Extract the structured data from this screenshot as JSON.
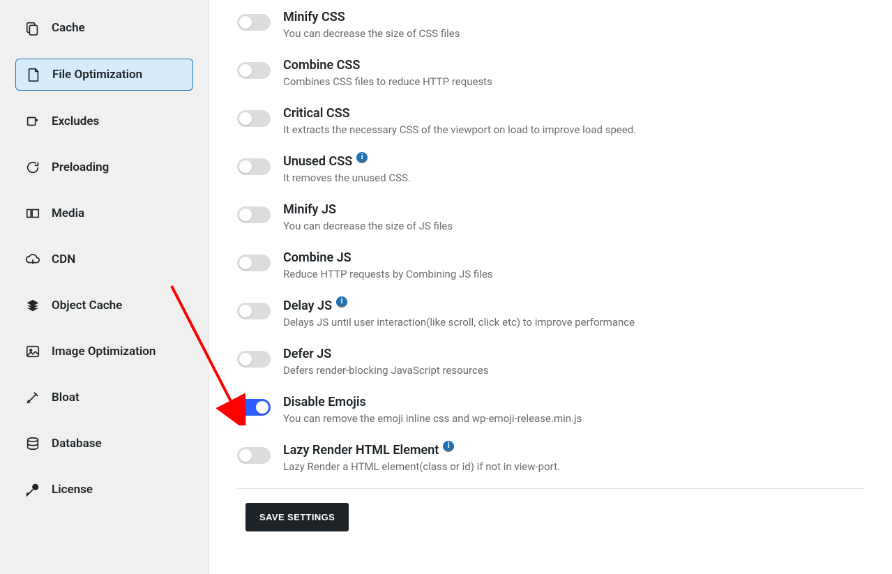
{
  "sidebar": {
    "items": [
      {
        "label": "Cache",
        "icon": "cache-icon",
        "active": false
      },
      {
        "label": "File Optimization",
        "icon": "file-icon",
        "active": true
      },
      {
        "label": "Excludes",
        "icon": "excludes-icon",
        "active": false
      },
      {
        "label": "Preloading",
        "icon": "preloading-icon",
        "active": false
      },
      {
        "label": "Media",
        "icon": "media-icon",
        "active": false
      },
      {
        "label": "CDN",
        "icon": "cdn-icon",
        "active": false
      },
      {
        "label": "Object Cache",
        "icon": "object-cache-icon",
        "active": false
      },
      {
        "label": "Image Optimization",
        "icon": "image-optimization-icon",
        "active": false
      },
      {
        "label": "Bloat",
        "icon": "bloat-icon",
        "active": false
      },
      {
        "label": "Database",
        "icon": "database-icon",
        "active": false
      },
      {
        "label": "License",
        "icon": "license-icon",
        "active": false
      }
    ]
  },
  "settings": [
    {
      "title": "Minify CSS",
      "desc": "You can decrease the size of CSS files",
      "info": false,
      "enabled": false
    },
    {
      "title": "Combine CSS",
      "desc": "Combines CSS files to reduce HTTP requests",
      "info": false,
      "enabled": false
    },
    {
      "title": "Critical CSS",
      "desc": "It extracts the necessary CSS of the viewport on load to improve load speed.",
      "info": false,
      "enabled": false
    },
    {
      "title": "Unused CSS",
      "desc": "It removes the unused CSS.",
      "info": true,
      "enabled": false
    },
    {
      "title": "Minify JS",
      "desc": "You can decrease the size of JS files",
      "info": false,
      "enabled": false
    },
    {
      "title": "Combine JS",
      "desc": "Reduce HTTP requests by Combining JS files",
      "info": false,
      "enabled": false
    },
    {
      "title": "Delay JS",
      "desc": "Delays JS until user interaction(like scroll, click etc) to improve performance",
      "info": true,
      "enabled": false
    },
    {
      "title": "Defer JS",
      "desc": "Defers render-blocking JavaScript resources",
      "info": false,
      "enabled": false
    },
    {
      "title": "Disable Emojis",
      "desc": "You can remove the emoji inline css and wp-emoji-release.min.js",
      "info": false,
      "enabled": true
    },
    {
      "title": "Lazy Render HTML Element",
      "desc": "Lazy Render a HTML element(class or id) if not in view-port.",
      "info": true,
      "enabled": false
    }
  ],
  "actions": {
    "save_label": "SAVE SETTINGS"
  },
  "info_glyph": "i",
  "annotation": {
    "arrow_color": "#ff0000"
  }
}
